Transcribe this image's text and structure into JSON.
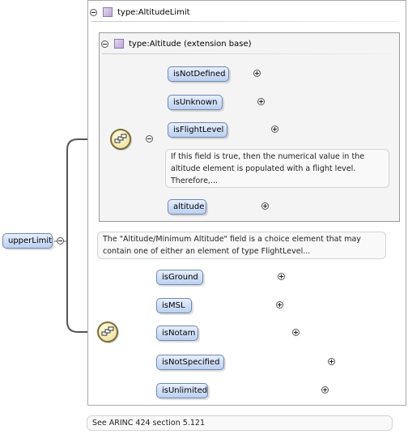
{
  "root": {
    "label": "upperLimit"
  },
  "altitude_limit": {
    "type_label": "type:AltitudeLimit"
  },
  "altitude": {
    "type_label": "type:Altitude (extension base)",
    "elements": [
      {
        "label": "isNotDefined"
      },
      {
        "label": "isUnknown"
      },
      {
        "label": "isFlightLevel"
      },
      {
        "label": "altitude"
      }
    ],
    "flight_level_note": "If this field is true, then the numerical value in the altitude element is populated with a flight level. Therefore,..."
  },
  "choice_note": "The \"Altitude/Minimum Altitude\" field is a choice element that may contain one of either an element of type FlightLevel...",
  "limit_elements": [
    {
      "label": "isGround"
    },
    {
      "label": "isMSL"
    },
    {
      "label": "isNotam"
    },
    {
      "label": "isNotSpecified"
    },
    {
      "label": "isUnlimited"
    }
  ],
  "footer_note": "See ARINC 424 section 5.121"
}
